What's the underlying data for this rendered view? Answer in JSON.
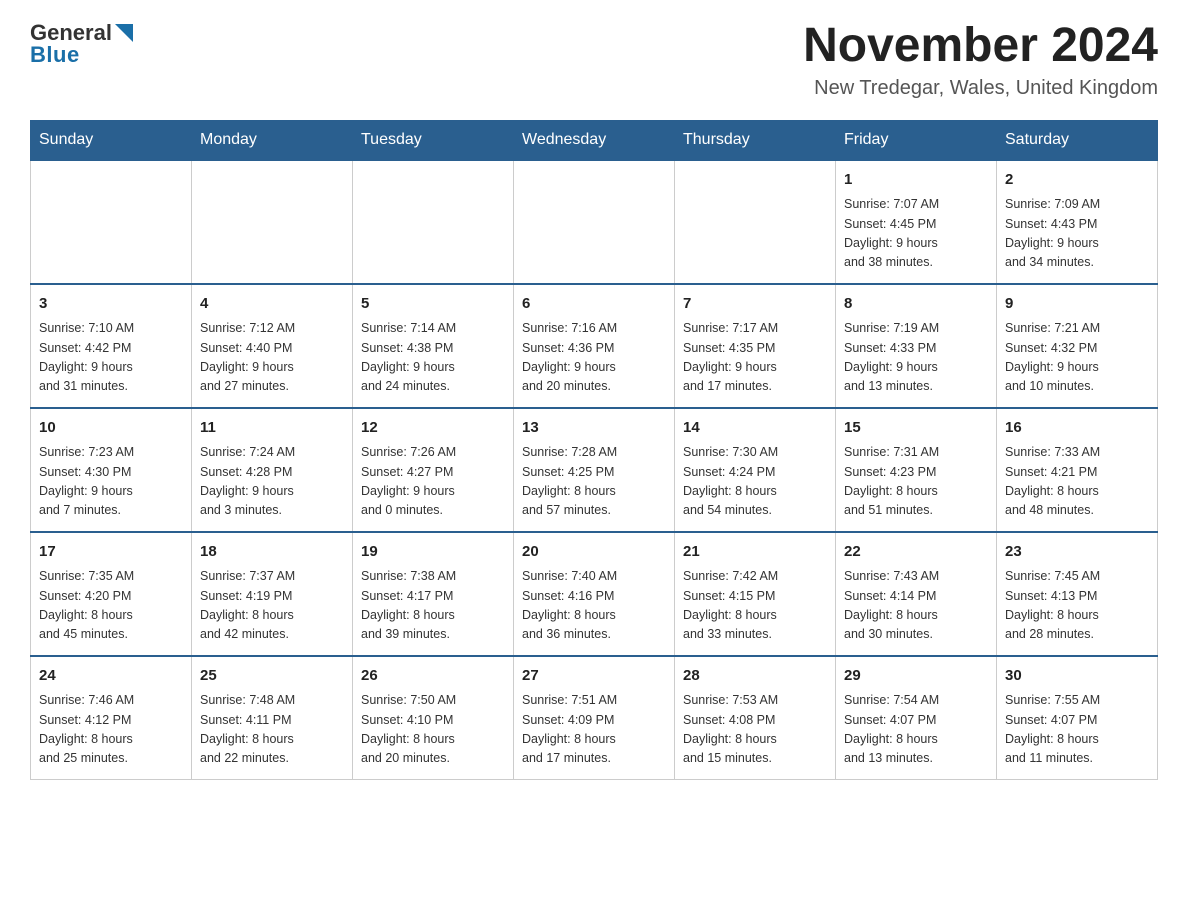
{
  "header": {
    "logo": {
      "general": "General",
      "blue": "Blue"
    },
    "title": "November 2024",
    "location": "New Tredegar, Wales, United Kingdom"
  },
  "weekdays": [
    "Sunday",
    "Monday",
    "Tuesday",
    "Wednesday",
    "Thursday",
    "Friday",
    "Saturday"
  ],
  "weeks": [
    {
      "days": [
        {
          "num": "",
          "info": ""
        },
        {
          "num": "",
          "info": ""
        },
        {
          "num": "",
          "info": ""
        },
        {
          "num": "",
          "info": ""
        },
        {
          "num": "",
          "info": ""
        },
        {
          "num": "1",
          "info": "Sunrise: 7:07 AM\nSunset: 4:45 PM\nDaylight: 9 hours\nand 38 minutes."
        },
        {
          "num": "2",
          "info": "Sunrise: 7:09 AM\nSunset: 4:43 PM\nDaylight: 9 hours\nand 34 minutes."
        }
      ]
    },
    {
      "days": [
        {
          "num": "3",
          "info": "Sunrise: 7:10 AM\nSunset: 4:42 PM\nDaylight: 9 hours\nand 31 minutes."
        },
        {
          "num": "4",
          "info": "Sunrise: 7:12 AM\nSunset: 4:40 PM\nDaylight: 9 hours\nand 27 minutes."
        },
        {
          "num": "5",
          "info": "Sunrise: 7:14 AM\nSunset: 4:38 PM\nDaylight: 9 hours\nand 24 minutes."
        },
        {
          "num": "6",
          "info": "Sunrise: 7:16 AM\nSunset: 4:36 PM\nDaylight: 9 hours\nand 20 minutes."
        },
        {
          "num": "7",
          "info": "Sunrise: 7:17 AM\nSunset: 4:35 PM\nDaylight: 9 hours\nand 17 minutes."
        },
        {
          "num": "8",
          "info": "Sunrise: 7:19 AM\nSunset: 4:33 PM\nDaylight: 9 hours\nand 13 minutes."
        },
        {
          "num": "9",
          "info": "Sunrise: 7:21 AM\nSunset: 4:32 PM\nDaylight: 9 hours\nand 10 minutes."
        }
      ]
    },
    {
      "days": [
        {
          "num": "10",
          "info": "Sunrise: 7:23 AM\nSunset: 4:30 PM\nDaylight: 9 hours\nand 7 minutes."
        },
        {
          "num": "11",
          "info": "Sunrise: 7:24 AM\nSunset: 4:28 PM\nDaylight: 9 hours\nand 3 minutes."
        },
        {
          "num": "12",
          "info": "Sunrise: 7:26 AM\nSunset: 4:27 PM\nDaylight: 9 hours\nand 0 minutes."
        },
        {
          "num": "13",
          "info": "Sunrise: 7:28 AM\nSunset: 4:25 PM\nDaylight: 8 hours\nand 57 minutes."
        },
        {
          "num": "14",
          "info": "Sunrise: 7:30 AM\nSunset: 4:24 PM\nDaylight: 8 hours\nand 54 minutes."
        },
        {
          "num": "15",
          "info": "Sunrise: 7:31 AM\nSunset: 4:23 PM\nDaylight: 8 hours\nand 51 minutes."
        },
        {
          "num": "16",
          "info": "Sunrise: 7:33 AM\nSunset: 4:21 PM\nDaylight: 8 hours\nand 48 minutes."
        }
      ]
    },
    {
      "days": [
        {
          "num": "17",
          "info": "Sunrise: 7:35 AM\nSunset: 4:20 PM\nDaylight: 8 hours\nand 45 minutes."
        },
        {
          "num": "18",
          "info": "Sunrise: 7:37 AM\nSunset: 4:19 PM\nDaylight: 8 hours\nand 42 minutes."
        },
        {
          "num": "19",
          "info": "Sunrise: 7:38 AM\nSunset: 4:17 PM\nDaylight: 8 hours\nand 39 minutes."
        },
        {
          "num": "20",
          "info": "Sunrise: 7:40 AM\nSunset: 4:16 PM\nDaylight: 8 hours\nand 36 minutes."
        },
        {
          "num": "21",
          "info": "Sunrise: 7:42 AM\nSunset: 4:15 PM\nDaylight: 8 hours\nand 33 minutes."
        },
        {
          "num": "22",
          "info": "Sunrise: 7:43 AM\nSunset: 4:14 PM\nDaylight: 8 hours\nand 30 minutes."
        },
        {
          "num": "23",
          "info": "Sunrise: 7:45 AM\nSunset: 4:13 PM\nDaylight: 8 hours\nand 28 minutes."
        }
      ]
    },
    {
      "days": [
        {
          "num": "24",
          "info": "Sunrise: 7:46 AM\nSunset: 4:12 PM\nDaylight: 8 hours\nand 25 minutes."
        },
        {
          "num": "25",
          "info": "Sunrise: 7:48 AM\nSunset: 4:11 PM\nDaylight: 8 hours\nand 22 minutes."
        },
        {
          "num": "26",
          "info": "Sunrise: 7:50 AM\nSunset: 4:10 PM\nDaylight: 8 hours\nand 20 minutes."
        },
        {
          "num": "27",
          "info": "Sunrise: 7:51 AM\nSunset: 4:09 PM\nDaylight: 8 hours\nand 17 minutes."
        },
        {
          "num": "28",
          "info": "Sunrise: 7:53 AM\nSunset: 4:08 PM\nDaylight: 8 hours\nand 15 minutes."
        },
        {
          "num": "29",
          "info": "Sunrise: 7:54 AM\nSunset: 4:07 PM\nDaylight: 8 hours\nand 13 minutes."
        },
        {
          "num": "30",
          "info": "Sunrise: 7:55 AM\nSunset: 4:07 PM\nDaylight: 8 hours\nand 11 minutes."
        }
      ]
    }
  ]
}
